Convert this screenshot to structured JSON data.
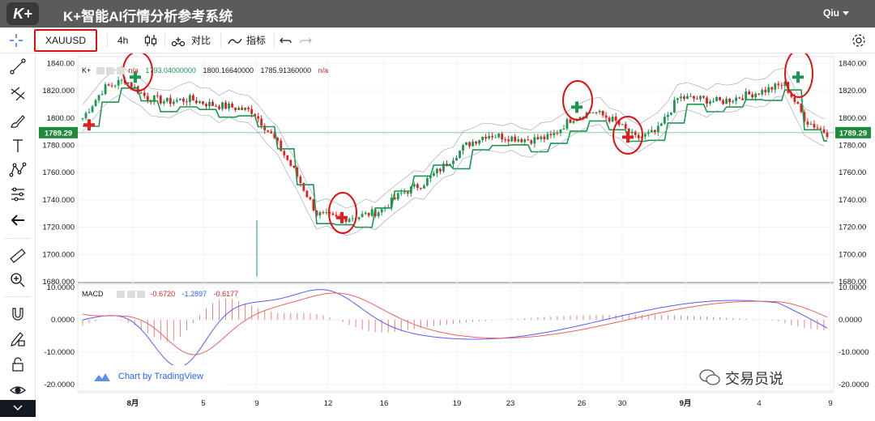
{
  "app": {
    "logo": "K+",
    "title": "K+智能AI行情分析参考系统",
    "user": "Qiu"
  },
  "toolbar": {
    "symbol": "XAUUSD",
    "interval": "4h",
    "compare_label": "对比",
    "indicators_label": "指标"
  },
  "legend": {
    "main_label": "K+",
    "main_na1": "n/a",
    "value1": "1793.04000000",
    "value2": "1800.16640000",
    "value3": "1785.91360000",
    "main_na2": "n/a",
    "macd_label": "MACD",
    "macd_values": [
      "-0.6720",
      "-1.2897",
      "-0.6177"
    ]
  },
  "price_axis": {
    "ticks": [
      "1840.00",
      "1820.000",
      "1800.00",
      "1780.000",
      "1760.000",
      "1740.000",
      "1720.000",
      "1700.000",
      "1680.000"
    ],
    "right_ticks": [
      "1840.00",
      "1820.00",
      "1800.00",
      "1780.00",
      "1760.00",
      "1740.00",
      "1720.00",
      "1700.00",
      "1680.00"
    ],
    "current_price": "1789.29"
  },
  "macd_axis": {
    "ticks": [
      "10.0000",
      "0.0000",
      "-10.0000",
      "-20.0000"
    ]
  },
  "time_axis": {
    "ticks": [
      "8月",
      "5",
      "9",
      "12",
      "16",
      "19",
      "23",
      "26",
      "30",
      "9月",
      "4",
      "9"
    ]
  },
  "branding": {
    "tradingview": "Chart by TradingView",
    "watermark": "交易员说"
  },
  "colors": {
    "up": "#1a9850",
    "down": "#e02020",
    "signal_circle": "#e01010",
    "accent": "#2962ff",
    "price_tag": "#1e8a3a"
  },
  "chart_data": {
    "type": "candlestick",
    "series_name": "XAUUSD",
    "interval": "4h",
    "ylim": [
      1680,
      1845
    ],
    "current_price": 1789.29,
    "close_path": [
      1800,
      1822,
      1828,
      1815,
      1812,
      1814,
      1810,
      1808,
      1805,
      1785,
      1760,
      1730,
      1726,
      1728,
      1732,
      1745,
      1752,
      1765,
      1780,
      1788,
      1786,
      1784,
      1786,
      1800,
      1805,
      1798,
      1785,
      1790,
      1815,
      1814,
      1812,
      1816,
      1820,
      1825,
      1798,
      1789
    ],
    "signals": [
      {
        "type": "buy",
        "price": 1830
      },
      {
        "type": "sell",
        "price": 1795
      },
      {
        "type": "sell",
        "price": 1727
      },
      {
        "type": "buy",
        "price": 1808
      },
      {
        "type": "sell",
        "price": 1786
      },
      {
        "type": "buy",
        "price": 1830
      }
    ],
    "macd": {
      "ylim": [
        -22,
        11
      ],
      "last": [
        -0.672,
        -1.2897,
        -0.6177
      ]
    }
  }
}
